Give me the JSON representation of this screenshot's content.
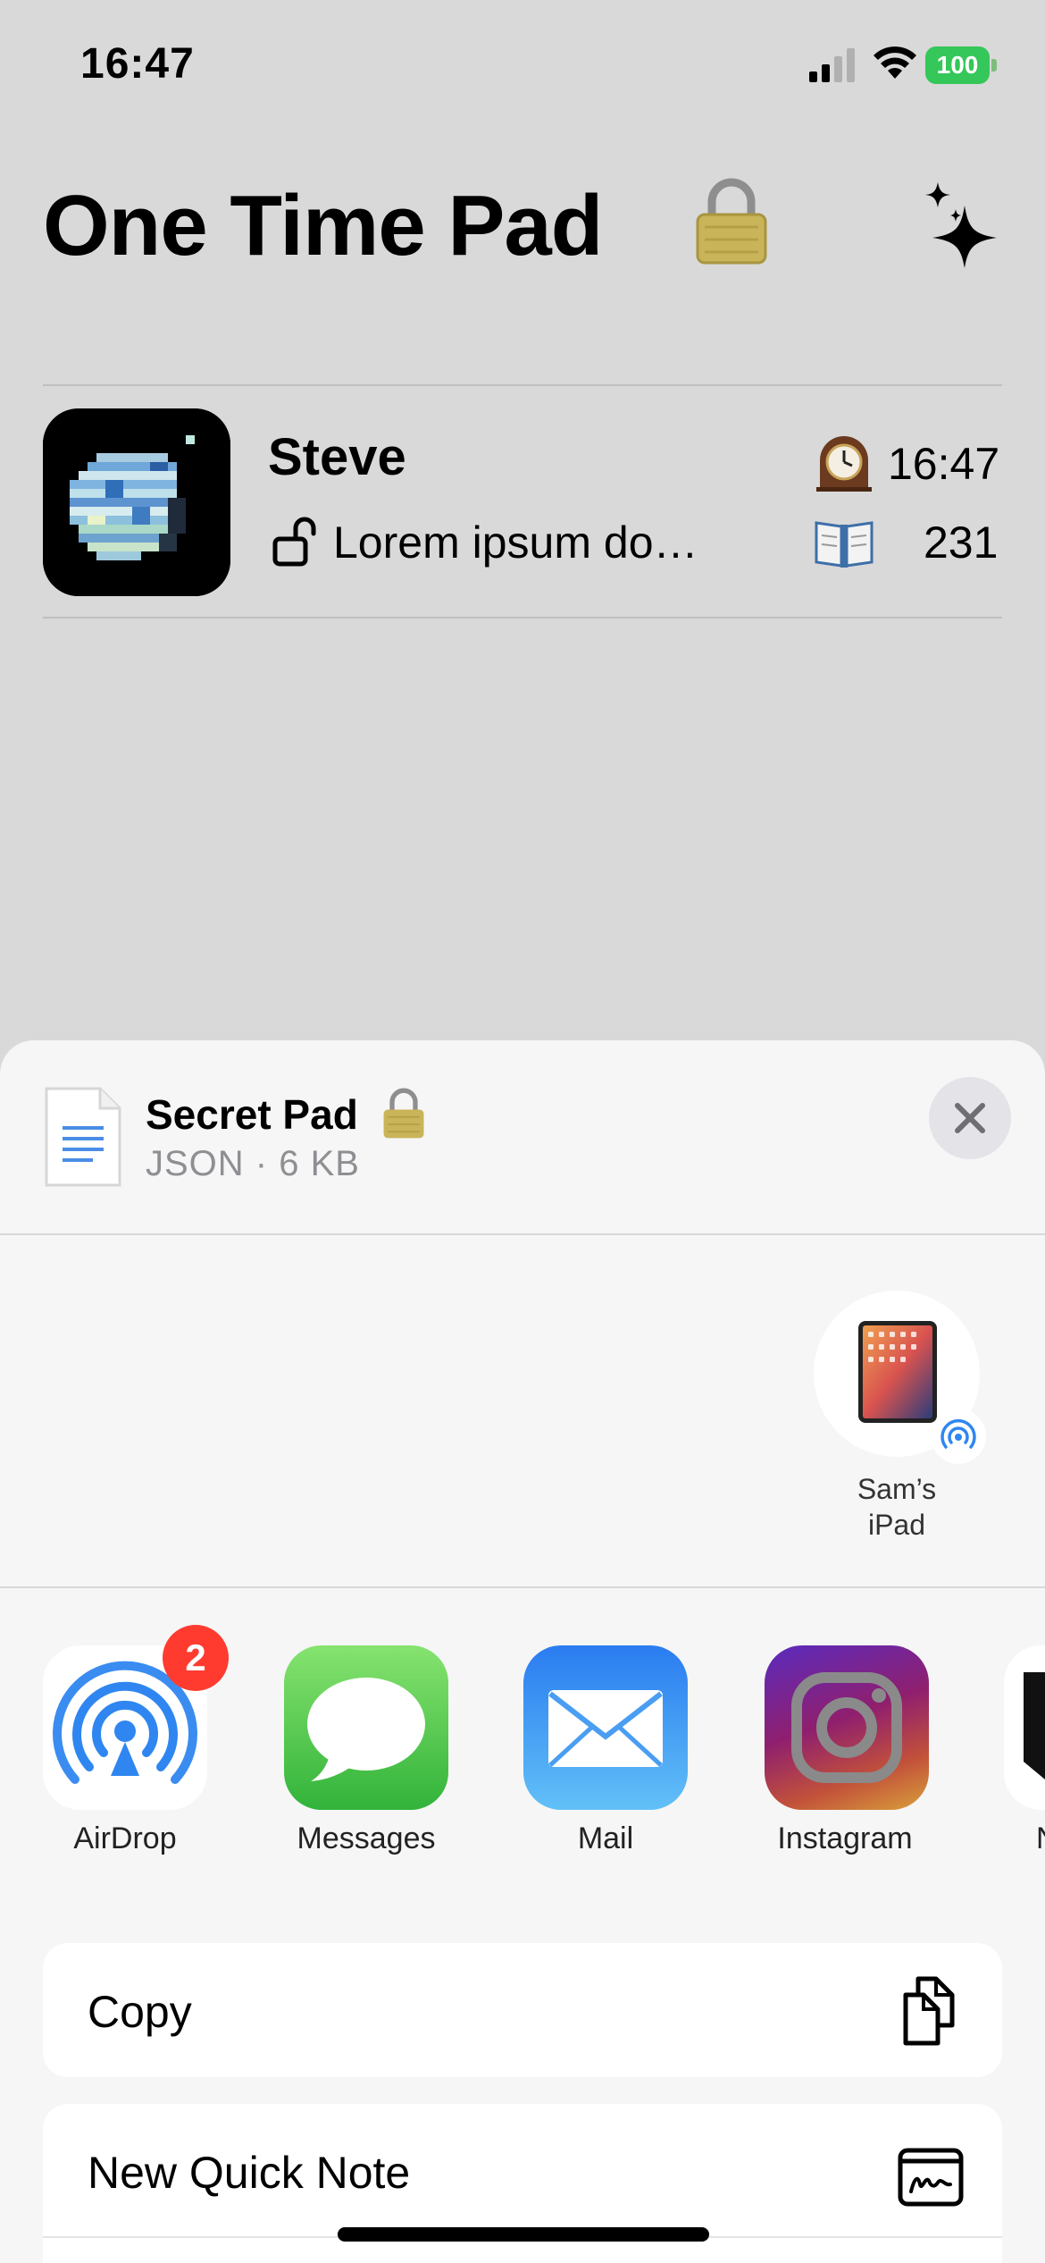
{
  "status_bar": {
    "time": "16:47",
    "battery": "100"
  },
  "header": {
    "title": "One Time Pad"
  },
  "conversation": {
    "name": "Steve",
    "preview": "Lorem ipsum do…",
    "time": "16:47",
    "count": "231"
  },
  "share_sheet": {
    "file_name": "Secret Pad",
    "file_meta": "JSON · 6 KB",
    "airdrop_device": {
      "label_line1": "Sam’s",
      "label_line2": "iPad"
    },
    "apps": [
      {
        "label": "AirDrop",
        "badge": "2"
      },
      {
        "label": "Messages"
      },
      {
        "label": "Mail"
      },
      {
        "label": "Instagram"
      },
      {
        "label": "N"
      }
    ],
    "actions": [
      {
        "label": "Copy",
        "icon": "copy-icon"
      },
      {
        "label": "New Quick Note",
        "icon": "quick-note-icon"
      }
    ]
  },
  "colors": {
    "background": "#d9d9d9",
    "sheet": "#f6f6f6",
    "battery_green": "#35c759",
    "badge_red": "#ff3b30"
  }
}
